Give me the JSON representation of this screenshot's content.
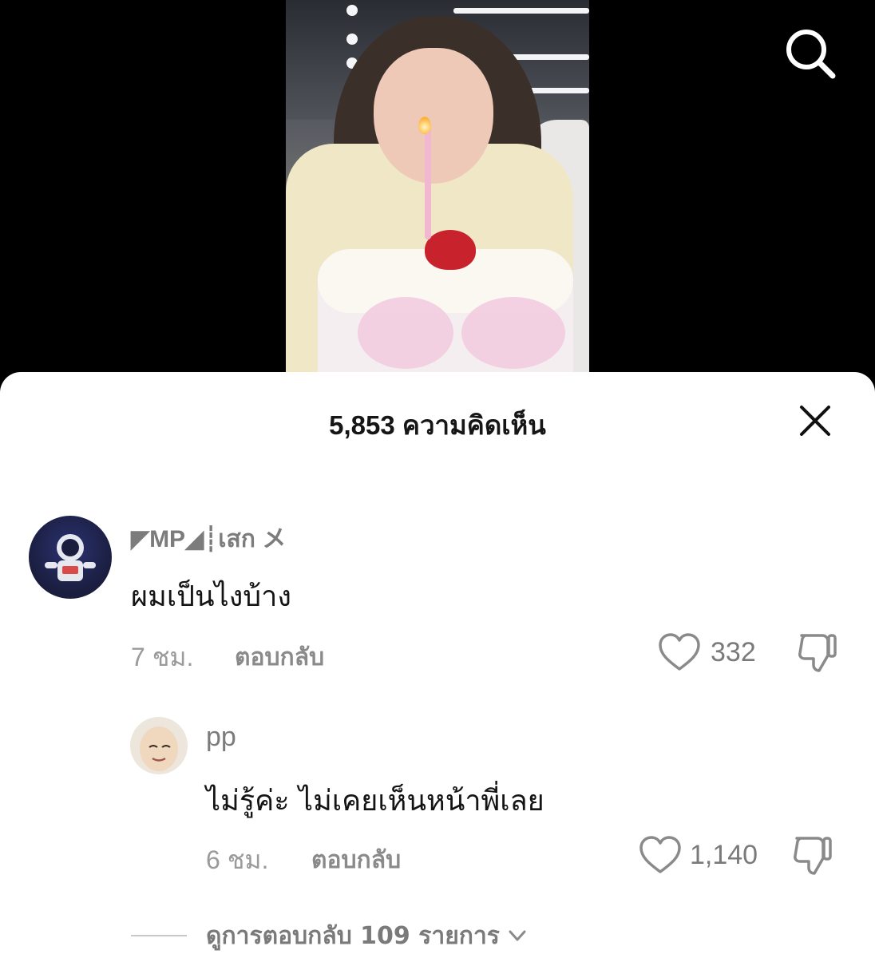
{
  "header": {
    "comment_count_label": "5,853 ความคิดเห็น"
  },
  "comments": [
    {
      "username": "◤MP◢┊เสก メ",
      "text": "ผมเป็นไงบ้าง",
      "time": "7 ชม.",
      "reply_label": "ตอบกลับ",
      "likes": "332"
    },
    {
      "username": "pp",
      "text": "ไม่รู้ค่ะ ไม่เคยเห็นหน้าพี่เลย",
      "time": "6 ชม.",
      "reply_label": "ตอบกลับ",
      "likes": "1,140"
    }
  ],
  "view_replies": {
    "label": "ดูการตอบกลับ 109 รายการ"
  },
  "icons": {
    "search": "search-icon",
    "close": "close-icon",
    "like": "heart-icon",
    "dislike": "thumbs-down-icon",
    "expand": "chevron-down-icon"
  }
}
